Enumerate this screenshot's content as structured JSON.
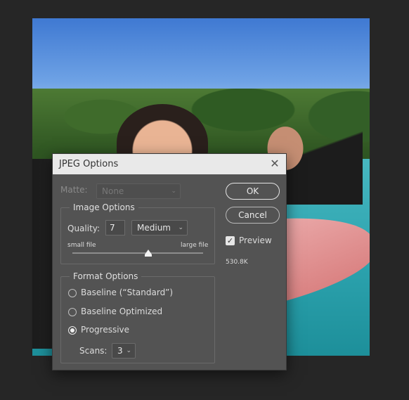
{
  "dialog": {
    "title": "JPEG Options",
    "matte": {
      "label": "Matte:",
      "value": "None"
    },
    "image_options": {
      "group_title": "Image Options",
      "quality_label": "Quality:",
      "quality_value": "7",
      "quality_preset": "Medium",
      "slider_min_label": "small file",
      "slider_max_label": "large file",
      "slider_fraction": 0.58
    },
    "format_options": {
      "group_title": "Format Options",
      "options": [
        "Baseline (“Standard”)",
        "Baseline Optimized",
        "Progressive"
      ],
      "selected": "Progressive",
      "scans_label": "Scans:",
      "scans_value": "3"
    },
    "ok_label": "OK",
    "cancel_label": "Cancel",
    "preview_label": "Preview",
    "preview_checked": true,
    "file_size": "530.8K"
  },
  "icons": {
    "close": "close-icon",
    "chevron": "chevron-down-icon",
    "checkmark": "checkmark-icon"
  }
}
